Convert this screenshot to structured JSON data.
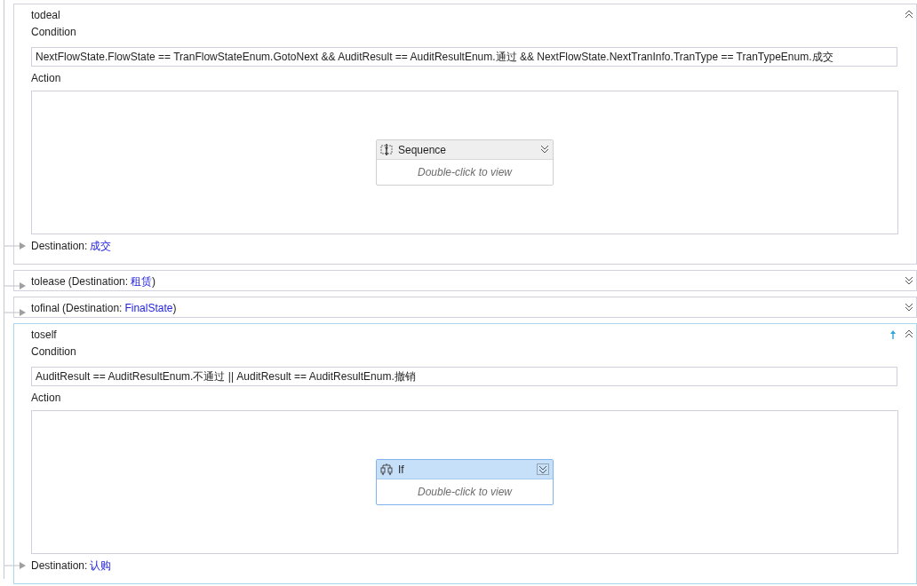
{
  "transitions": [
    {
      "name": "todeal",
      "expanded": true,
      "selected": false,
      "condition_label": "Condition",
      "condition": "NextFlowState.FlowState == TranFlowStateEnum.GotoNext && AuditResult == AuditResultEnum.通过 && NextFlowState.NextTranInfo.TranType == TranTypeEnum.成交",
      "action_label": "Action",
      "activity": {
        "kind": "sequence",
        "name": "Sequence",
        "hint": "Double-click to view",
        "selected": false
      },
      "destination_label": "Destination:",
      "destination": "成交"
    },
    {
      "name": "tolease",
      "expanded": false,
      "selected": false,
      "summary_prefix": "(Destination:",
      "destination": "租赁",
      "summary_suffix": ")"
    },
    {
      "name": "tofinal",
      "expanded": false,
      "selected": false,
      "summary_prefix": "(Destination:",
      "destination": "FinalState",
      "summary_suffix": ")"
    },
    {
      "name": "toself",
      "expanded": true,
      "selected": true,
      "condition_label": "Condition",
      "condition": "AuditResult == AuditResultEnum.不通过 || AuditResult == AuditResultEnum.撤销",
      "action_label": "Action",
      "activity": {
        "kind": "if",
        "name": "If",
        "hint": "Double-click to view",
        "selected": true
      },
      "destination_label": "Destination:",
      "destination": "认购"
    }
  ]
}
